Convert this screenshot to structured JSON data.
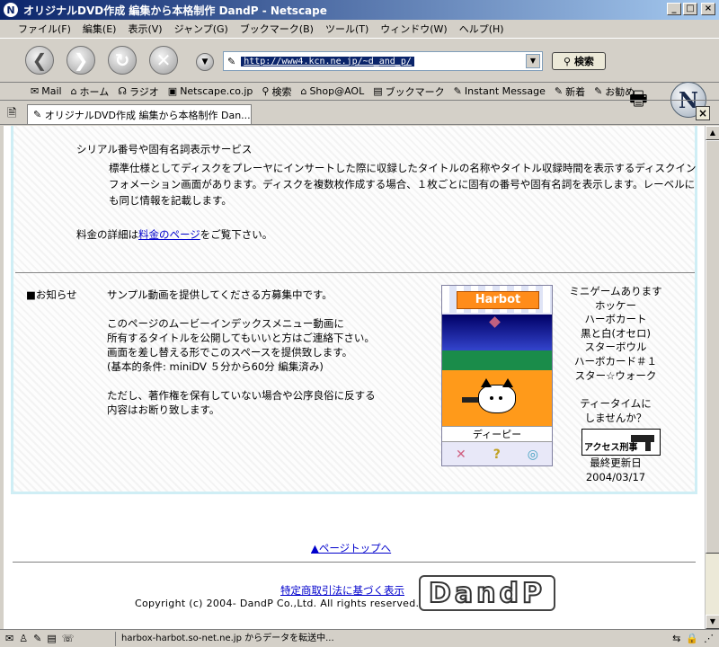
{
  "window": {
    "title": "オリジナルDVD作成 編集から本格制作 DandP - Netscape",
    "minimize": "_",
    "maximize": "□",
    "close": "×"
  },
  "menu": [
    "ファイル(F)",
    "編集(E)",
    "表示(V)",
    "ジャンプ(G)",
    "ブックマーク(B)",
    "ツール(T)",
    "ウィンドウ(W)",
    "ヘルプ(H)"
  ],
  "nav": {
    "url": "http://www4.kcn.ne.jp/~d_and_p/",
    "search_label": "検索"
  },
  "personal_toolbar": [
    {
      "icon": "✉",
      "label": "Mail"
    },
    {
      "icon": "⌂",
      "label": "ホーム"
    },
    {
      "icon": "☊",
      "label": "ラジオ"
    },
    {
      "icon": "▣",
      "label": "Netscape.co.jp"
    },
    {
      "icon": "⚲",
      "label": "検索"
    },
    {
      "icon": "⌂",
      "label": "Shop@AOL"
    },
    {
      "icon": "▤",
      "label": "ブックマーク"
    },
    {
      "icon": "✎",
      "label": "Instant Message"
    },
    {
      "icon": "✎",
      "label": "新着"
    },
    {
      "icon": "✎",
      "label": "お勧め"
    }
  ],
  "tab": {
    "label": "オリジナルDVD作成 編集から本格制作 Dan..."
  },
  "content": {
    "section_title": "シリアル番号や固有名詞表示サービス",
    "section_body": "標準仕様としてディスクをプレーヤにインサートした際に収録したタイトルの名称やタイトル収録時間を表示するディスクインフォメーション画面があります。ディスクを複数枚作成する場合、１枚ごとに固有の番号や固有名詞を表示します。レーベルにも同じ情報を記載します。",
    "fee_prefix": "料金の詳細は",
    "fee_link": "料金のページ",
    "fee_suffix": "をご覧下さい。",
    "news_label": "■お知らせ",
    "news_p1": "サンプル動画を提供してくださる方募集中です。",
    "news_p2_lines": [
      "このページのムービーインデックスメニュー動画に",
      "所有するタイトルを公開してもいいと方はご連絡下さい。",
      "画面を差し替える形でこのスペースを提供致します。",
      "(基本的条件: miniDV ５分から60分 編集済み)"
    ],
    "news_p3_lines": [
      "ただし、著作権を保有していない場合や公序良俗に反する",
      "内容はお断り致します。"
    ],
    "game": {
      "logo": "Harbot",
      "name": "ディーピー",
      "ctrl_x": "✕",
      "ctrl_q": "?",
      "ctrl_o": "◎"
    },
    "side_items": [
      "ミニゲームあります",
      "ホッケー",
      "ハーボカート",
      "黒と白(オセロ)",
      "スターボウル",
      "ハーボカード＃１",
      "スター☆ウォーク"
    ],
    "tea_lines": [
      "ティータイムに",
      "しませんか？"
    ],
    "access_label": "アクセス刑事",
    "updated_label": "最終更新日",
    "updated_date": "2004/03/17",
    "page_top": "▲ページトップへ",
    "law_link": "特定商取引法に基づく表示",
    "copyright": "Copyright (c) 2004- DandP Co.,Ltd. All rights reserved.",
    "logo_text": "DandP"
  },
  "status": {
    "text": "harbox-harbot.so-net.ne.jp からデータを転送中..."
  }
}
